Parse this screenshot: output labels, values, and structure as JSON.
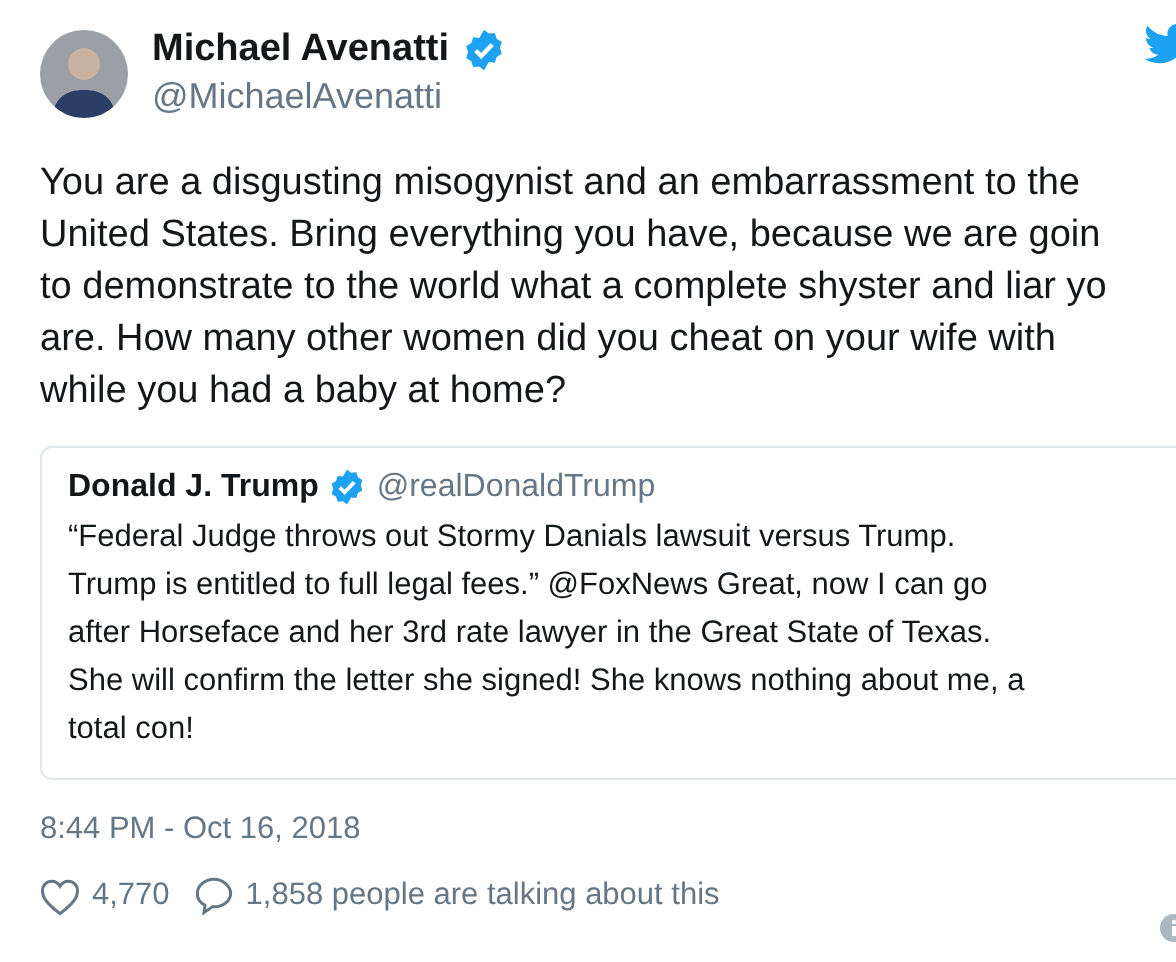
{
  "author": {
    "name": "Michael Avenatti",
    "handle": "@MichaelAvenatti",
    "verified": true
  },
  "text_lines": [
    "You are a disgusting misogynist and an embarrassment to the",
    "United States. Bring everything you have, because we are goin",
    "to demonstrate to the world what a complete shyster and liar yo",
    "are. How many other women did you cheat on your wife with",
    "while you had a baby at home?"
  ],
  "quoted_tweet": {
    "name": "Donald J. Trump",
    "handle": "@realDonaldTrump",
    "verified": true,
    "text_lines": [
      "“Federal Judge throws out Stormy Danials lawsuit versus Trump.",
      "Trump is entitled to full legal fees.” @FoxNews Great, now I can go",
      "after Horseface and her 3rd rate lawyer in the Great State of Texas.",
      "She will confirm the letter she signed! She knows nothing about me, a",
      "total con!"
    ]
  },
  "timestamp": "8:44 PM - Oct 16, 2018",
  "likes": "4,770",
  "talking": "1,858 people are talking about this"
}
